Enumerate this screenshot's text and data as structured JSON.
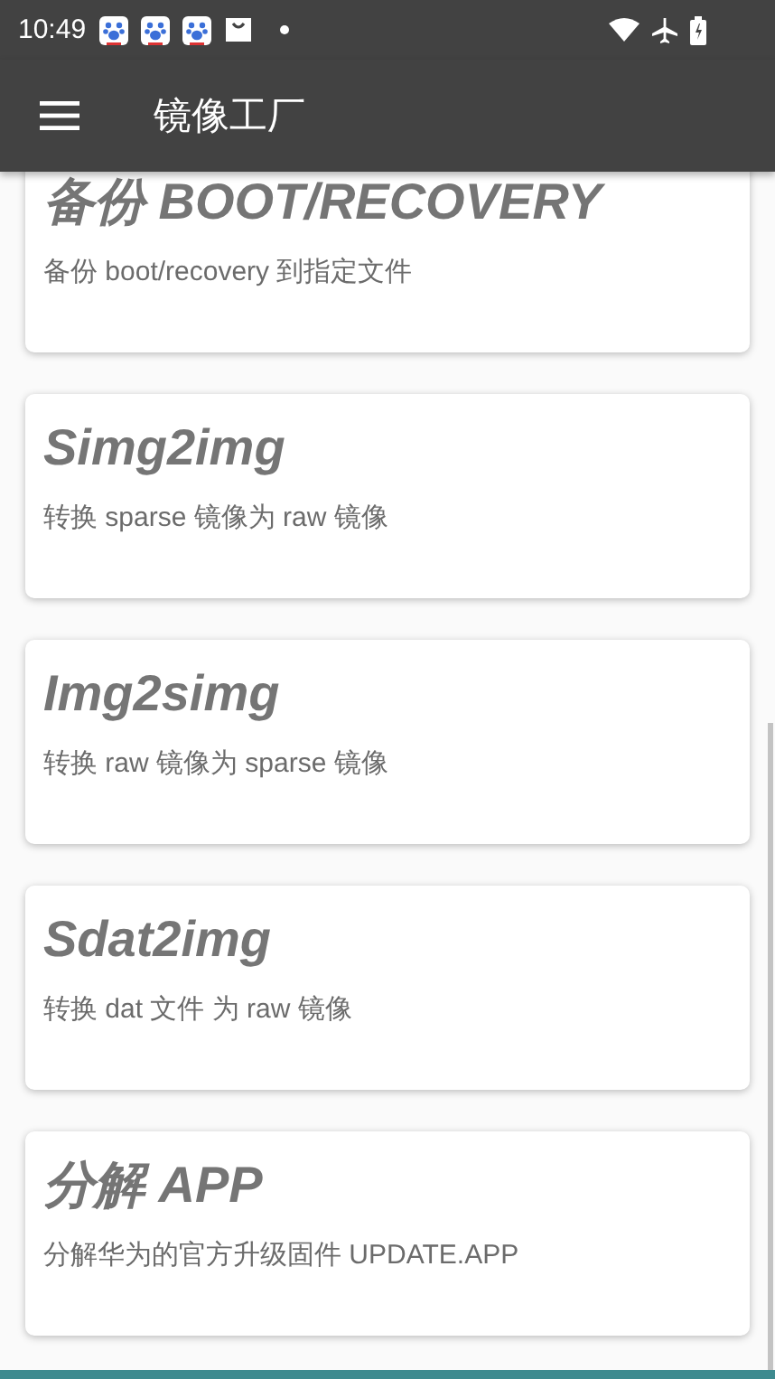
{
  "status_bar": {
    "time": "10:49"
  },
  "app_bar": {
    "title": "镜像工厂"
  },
  "cards": [
    {
      "title": "备份 BOOT/RECOVERY",
      "description": "备份 boot/recovery 到指定文件"
    },
    {
      "title": "Simg2img",
      "description": "转换 sparse 镜像为 raw 镜像"
    },
    {
      "title": "Img2simg",
      "description": "转换 raw 镜像为 sparse 镜像"
    },
    {
      "title": "Sdat2img",
      "description": "转换 dat 文件 为 raw 镜像"
    },
    {
      "title": "分解 APP",
      "description": "分解华为的官方升级固件 UPDATE.APP"
    }
  ]
}
